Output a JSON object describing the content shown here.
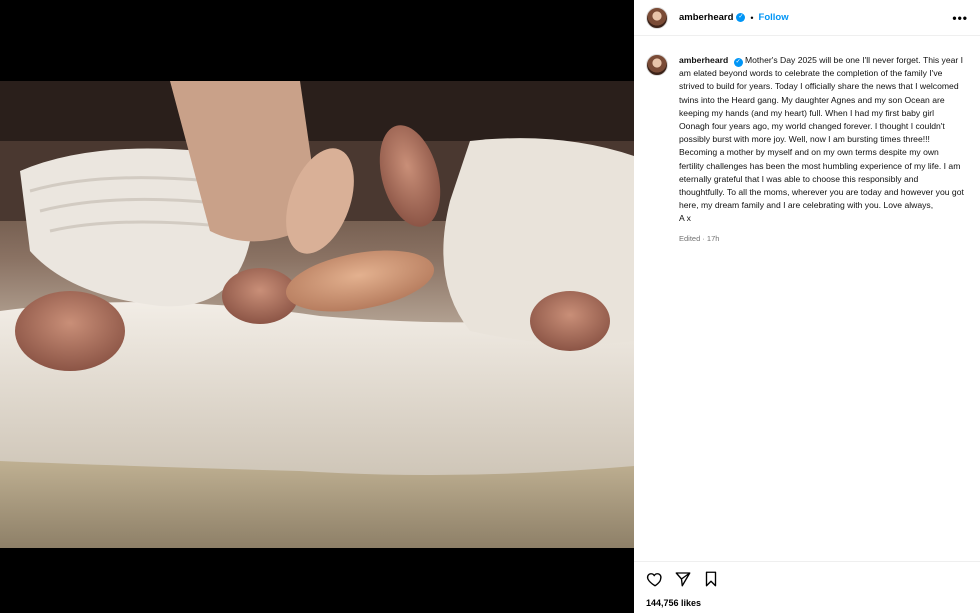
{
  "post": {
    "username": "amberheard",
    "follow_label": "Follow",
    "dot": "•",
    "more_label": "•••",
    "caption": "Mother's Day 2025 will be one I'll never forget. This year I am elated beyond words to celebrate the completion of the family I've strived to build for years. Today I officially share the news that I welcomed twins into the Heard gang. My daughter Agnes and my son Ocean are keeping my hands (and my heart) full. When I had my first baby girl Oonagh four years ago, my world changed forever. I thought I couldn't possibly burst with more joy. Well, now I am bursting times three!!! Becoming a mother by myself and on my own terms despite my own fertility challenges has been the most humbling experience of my life. I am eternally grateful that I was able to choose this responsibly and thoughtfully. To all the moms, wherever you are today and however you got here, my dream family and I are celebrating with you. Love always,",
    "signoff": "A x",
    "edited": "Edited · 17h",
    "likes": "144,756 likes"
  },
  "icons": {
    "verified": "verified-badge-icon",
    "like": "heart-icon",
    "share": "send-icon",
    "save": "bookmark-icon",
    "more": "more-options-icon"
  },
  "colors": {
    "accent": "#0095f6",
    "muted": "#737373",
    "background_media": "#000000"
  }
}
